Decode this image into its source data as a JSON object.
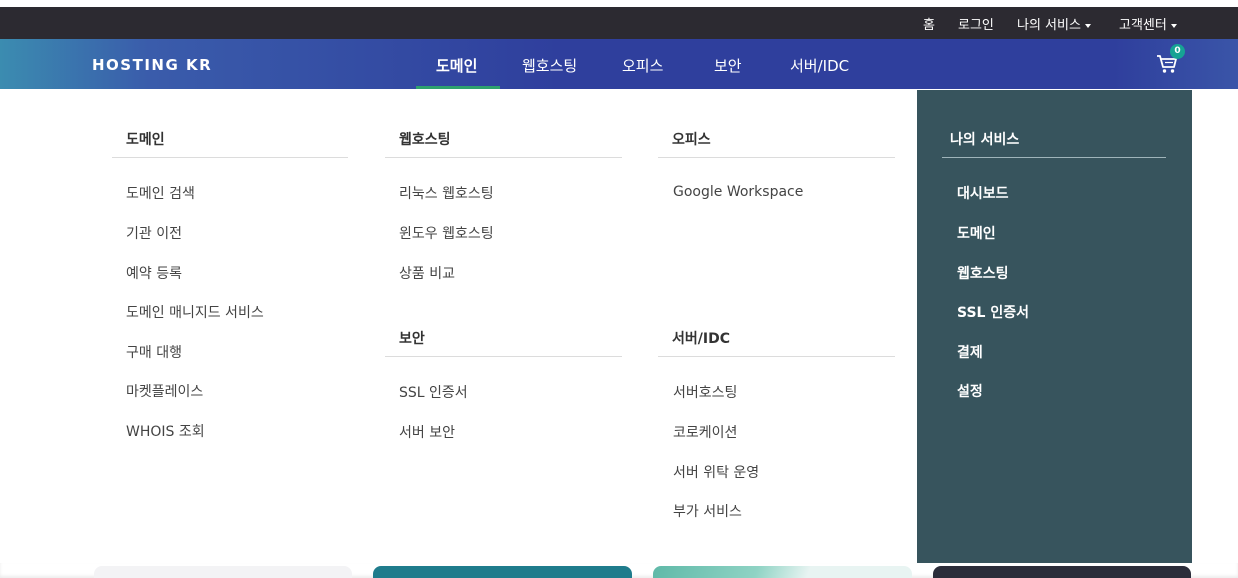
{
  "topbar": {
    "home": "홈",
    "login": "로그인",
    "my_services": "나의 서비스",
    "support": "고객센터"
  },
  "nav": {
    "logo": "HOSTING KR",
    "items": [
      "도메인",
      "웹호스팅",
      "오피스",
      "보안",
      "서버/IDC"
    ],
    "active": "도메인",
    "cart_count": "0"
  },
  "mega": {
    "domain": {
      "title": "도메인",
      "links": [
        "도메인 검색",
        "기관 이전",
        "예약 등록",
        "도메인 매니지드 서비스",
        "구매 대행",
        "마켓플레이스",
        "WHOIS 조회"
      ]
    },
    "webhosting": {
      "title": "웹호스팅",
      "links": [
        "리눅스 웹호스팅",
        "윈도우 웹호스팅",
        "상품 비교"
      ]
    },
    "security": {
      "title": "보안",
      "links": [
        "SSL 인증서",
        "서버 보안"
      ]
    },
    "office": {
      "title": "오피스",
      "links": [
        "Google Workspace"
      ]
    },
    "server": {
      "title": "서버/IDC",
      "links": [
        "서버호스팅",
        "코로케이션",
        "서버 위탁 운영",
        "부가 서비스"
      ]
    },
    "my_services": {
      "title": "나의 서비스",
      "links": [
        "대시보드",
        "도메인",
        "웹호스팅",
        "SSL 인증서",
        "결제",
        "설정"
      ]
    }
  },
  "colors": {
    "topbar_bg": "#2c2a31",
    "nav_bg": "#2f3f9d",
    "side_bg": "#37545d",
    "active_underline": "#2ea16e",
    "badge": "#16a394"
  }
}
